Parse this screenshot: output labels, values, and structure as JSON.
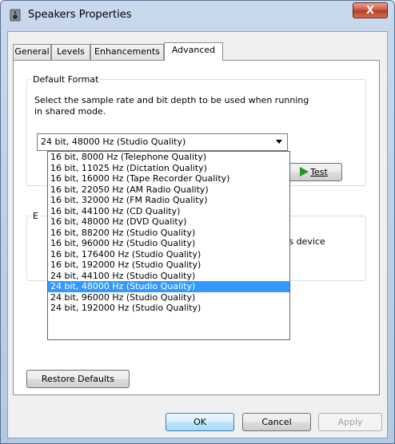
{
  "window": {
    "title": "Speakers Properties",
    "close_label": "X"
  },
  "tabs": [
    {
      "label": "General",
      "active": false
    },
    {
      "label": "Levels",
      "active": false
    },
    {
      "label": "Enhancements",
      "active": false
    },
    {
      "label": "Advanced",
      "active": true
    }
  ],
  "default_format": {
    "title": "Default Format",
    "description_line1": "Select the sample rate and bit depth to be used when running",
    "description_line2": "in shared mode.",
    "selected": "24 bit, 48000 Hz (Studio Quality)",
    "test_label": "Test"
  },
  "exclusive": {
    "title_fragment": "E",
    "text_fragment": "this device"
  },
  "dropdown": {
    "options": [
      "16 bit, 8000 Hz (Telephone Quality)",
      "16 bit, 11025 Hz (Dictation Quality)",
      "16 bit, 16000 Hz (Tape Recorder Quality)",
      "16 bit, 22050 Hz (AM Radio Quality)",
      "16 bit, 32000 Hz (FM Radio Quality)",
      "16 bit, 44100 Hz (CD Quality)",
      "16 bit, 48000 Hz (DVD Quality)",
      "16 bit, 88200 Hz (Studio Quality)",
      "16 bit, 96000 Hz (Studio Quality)",
      "16 bit, 176400 Hz (Studio Quality)",
      "16 bit, 192000 Hz (Studio Quality)",
      "24 bit, 44100 Hz (Studio Quality)",
      "24 bit, 48000 Hz (Studio Quality)",
      "24 bit, 96000 Hz (Studio Quality)",
      "24 bit, 192000 Hz (Studio Quality)"
    ],
    "selected_index": 12
  },
  "buttons": {
    "restore_label": "Restore Defaults",
    "ok_label": "OK",
    "cancel_label": "Cancel",
    "apply_label": "Apply"
  },
  "colors": {
    "selection": "#3399ff",
    "test_icon": "#1e9a1e",
    "close_button": "#c9503a"
  }
}
